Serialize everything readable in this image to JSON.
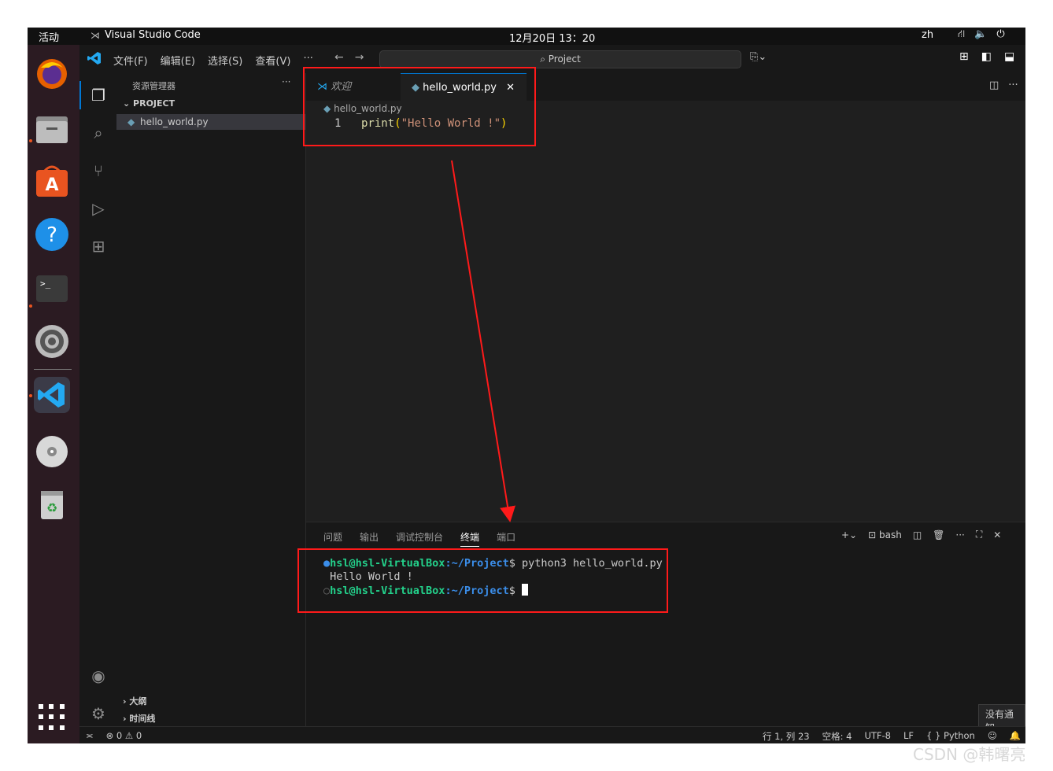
{
  "system": {
    "activities": "活动",
    "app_name": "Visual Studio Code",
    "clock": "12月20日  13：20",
    "lang": "zh"
  },
  "menu": [
    "文件(F)",
    "编辑(E)",
    "选择(S)",
    "查看(V)",
    "···"
  ],
  "search_placeholder": "Project",
  "sidebar": {
    "title": "资源管理器",
    "project": "PROJECT",
    "file": "hello_world.py",
    "outline": "大纲",
    "timeline": "时间线"
  },
  "tabs": {
    "welcome": "欢迎",
    "active": "hello_world.py"
  },
  "breadcrumb": "hello_world.py",
  "editor": {
    "line_number": "1",
    "code_fn": "print",
    "code_open": "(",
    "code_str": "\"Hello World !\"",
    "code_close": ")"
  },
  "panel": {
    "tabs": [
      "问题",
      "输出",
      "调试控制台",
      "终端",
      "端口"
    ],
    "shell": "bash"
  },
  "terminal": {
    "user": "hsl@hsl-VirtualBox",
    "path": ":~/Project",
    "prompt": "$",
    "command": " python3 hello_world.py",
    "output": "Hello World !"
  },
  "status": {
    "problems": "⊗ 0 ⚠ 0",
    "position": "行 1, 列 23",
    "spaces": "空格: 4",
    "encoding": "UTF-8",
    "eol": "LF",
    "language": "{ } Python"
  },
  "notification": "没有通知",
  "watermark": "CSDN @韩曙亮",
  "colors": {
    "highlight": "#ff1a1a",
    "accent": "#0078d4"
  }
}
